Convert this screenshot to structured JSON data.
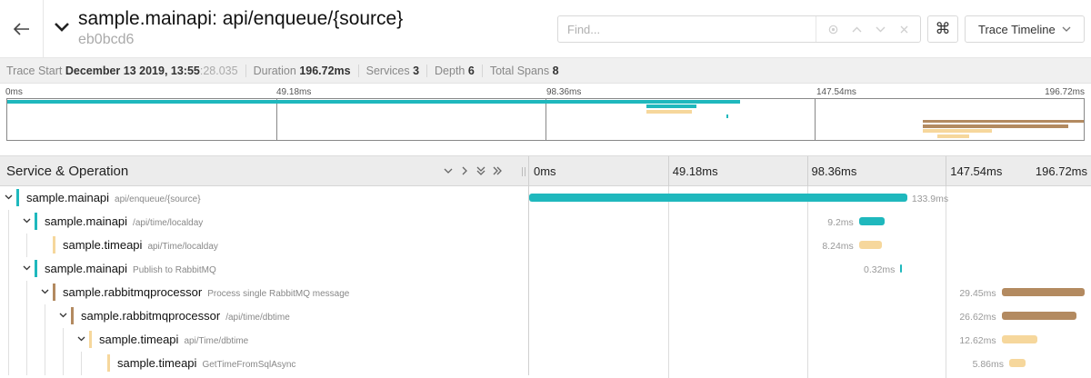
{
  "header": {
    "title": "sample.mainapi: api/enqueue/{source}",
    "trace_id": "eb0bcd6",
    "find_placeholder": "Find...",
    "keyboard_symbol": "⌘",
    "view_select": "Trace Timeline"
  },
  "summary": {
    "trace_start_label": "Trace Start",
    "trace_start_value": "December 13 2019, 13:55",
    "trace_start_ms": ":28.035",
    "duration_label": "Duration",
    "duration_value": "196.72ms",
    "services_label": "Services",
    "services_value": "3",
    "depth_label": "Depth",
    "depth_value": "6",
    "total_spans_label": "Total Spans",
    "total_spans_value": "8"
  },
  "timeline": {
    "total_ms": 196.72,
    "ticks": [
      "0ms",
      "49.18ms",
      "98.36ms",
      "147.54ms",
      "196.72ms"
    ],
    "column_title": "Service & Operation"
  },
  "colors": {
    "mainapi": "#1fb8bd",
    "timeapi": "#f6d79c",
    "rabbitmqprocessor": "#b38a60"
  },
  "spans": [
    {
      "service": "sample.mainapi",
      "operation": "api/enqueue/{source}",
      "depth": 0,
      "color": "#1fb8bd",
      "start_ms": 0,
      "duration_ms": 133.9,
      "label": "133.9ms",
      "expandable": true
    },
    {
      "service": "sample.mainapi",
      "operation": "/api/time/localday",
      "depth": 1,
      "color": "#1fb8bd",
      "start_ms": 116.8,
      "duration_ms": 9.2,
      "label": "9.2ms",
      "expandable": true
    },
    {
      "service": "sample.timeapi",
      "operation": "api/Time/localday",
      "depth": 2,
      "color": "#f6d79c",
      "start_ms": 116.8,
      "duration_ms": 8.24,
      "label": "8.24ms",
      "expandable": false
    },
    {
      "service": "sample.mainapi",
      "operation": "Publish to RabbitMQ",
      "depth": 1,
      "color": "#1fb8bd",
      "start_ms": 131.5,
      "duration_ms": 0.32,
      "label": "0.32ms",
      "expandable": true
    },
    {
      "service": "sample.rabbitmqprocessor",
      "operation": "Process single RabbitMQ message",
      "depth": 2,
      "color": "#b38a60",
      "start_ms": 167.3,
      "duration_ms": 29.45,
      "label": "29.45ms",
      "expandable": true
    },
    {
      "service": "sample.rabbitmqprocessor",
      "operation": "/api/time/dbtime",
      "depth": 3,
      "color": "#b38a60",
      "start_ms": 167.3,
      "duration_ms": 26.62,
      "label": "26.62ms",
      "expandable": true
    },
    {
      "service": "sample.timeapi",
      "operation": "api/Time/dbtime",
      "depth": 4,
      "color": "#f6d79c",
      "start_ms": 167.3,
      "duration_ms": 12.62,
      "label": "12.62ms",
      "expandable": true
    },
    {
      "service": "sample.timeapi",
      "operation": "GetTimeFromSqlAsync",
      "depth": 5,
      "color": "#f6d79c",
      "start_ms": 170.0,
      "duration_ms": 5.86,
      "label": "5.86ms",
      "expandable": false
    }
  ]
}
